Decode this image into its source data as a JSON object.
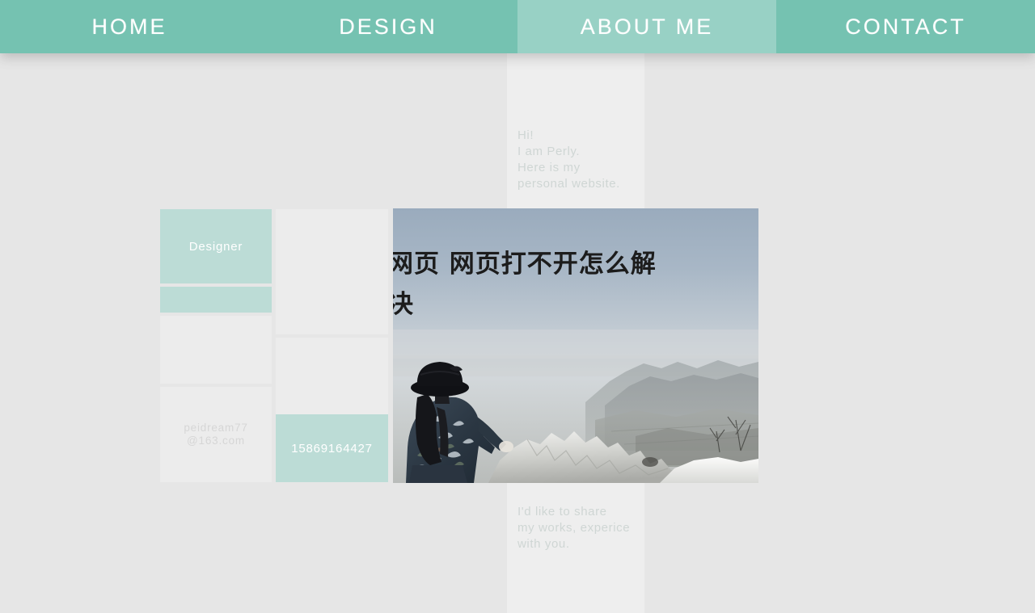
{
  "nav": {
    "items": [
      {
        "label": "HOME",
        "name": "nav-item-home",
        "active": false
      },
      {
        "label": "DESIGN",
        "name": "nav-item-design",
        "active": false
      },
      {
        "label": "ABOUT ME",
        "name": "nav-item-about-me",
        "active": true
      },
      {
        "label": "CONTACT",
        "name": "nav-item-contact",
        "active": false
      }
    ]
  },
  "intro": {
    "text": "Hi!\nI am Perly.\nHere is my\npersonal website."
  },
  "outro": {
    "text": "I'd like to share\nmy works, experice\nwith you."
  },
  "tiles": {
    "role_label": "Designer",
    "email_label": "peidream77\n@163.com",
    "phone_label": "15869164427"
  },
  "photo": {
    "overlay_title": "网页 网页打不开怎么解决",
    "alt": "woman-in-black-hat-looking-at-hazy-mountain-landscape"
  },
  "colors": {
    "nav_teal": "#75c2b1",
    "tile_teal": "#bcdcd6",
    "tile_grey": "#ececec",
    "page_bg": "#e6e6e6",
    "column_bg": "#eeeeee",
    "faded_text": "#cfd6d4"
  }
}
